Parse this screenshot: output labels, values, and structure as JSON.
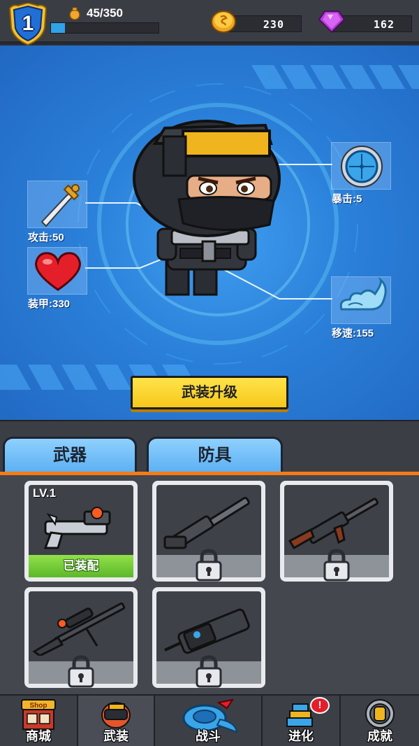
{
  "player": {
    "level": "1",
    "xp_text": "45/350",
    "xp_progress": 0.13
  },
  "resources": {
    "coins": "230",
    "gems": "162"
  },
  "stats": {
    "attack": "攻击:50",
    "armor": "装甲:330",
    "crit": "暴击:5",
    "speed": "移速:155"
  },
  "upgrade_button": "武装升级",
  "tabs": [
    {
      "label": "武器"
    },
    {
      "label": "防具"
    }
  ],
  "weapons": [
    {
      "level": "LV.1",
      "status": "已装配",
      "icon": "pistol-icon"
    },
    {
      "icon": "shotgun-icon",
      "locked": true
    },
    {
      "icon": "assault-rifle-icon",
      "locked": true
    },
    {
      "icon": "sniper-rifle-icon",
      "locked": true
    },
    {
      "icon": "minigun-icon",
      "locked": true
    }
  ],
  "nav": [
    {
      "label": "商城",
      "icon": "shop-icon",
      "icon_text": "Shop"
    },
    {
      "label": "武装",
      "icon": "armory-icon"
    },
    {
      "label": "战斗",
      "icon": "battle-icon"
    },
    {
      "label": "进化",
      "icon": "evolve-icon",
      "badge": "!"
    },
    {
      "label": "成就",
      "icon": "achievement-icon"
    }
  ],
  "colors": {
    "accent_blue": "#2ea3e8",
    "tab_line_orange": "#f47b18",
    "button_yellow": "#f6c81a",
    "equipped_green": "#5cb828"
  }
}
